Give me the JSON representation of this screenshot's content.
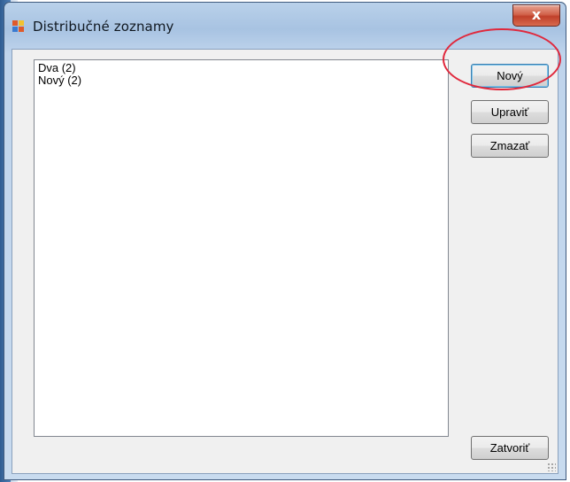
{
  "window": {
    "title": "Distribučné zoznamy",
    "close_glyph": "x"
  },
  "list": {
    "items": [
      {
        "label": "Dva (2)"
      },
      {
        "label": "Nový (2)"
      }
    ]
  },
  "buttons": {
    "new_label": "Nový",
    "edit_label": "Upraviť",
    "delete_label": "Zmazať",
    "close_label": "Zatvoriť"
  },
  "annotation": {
    "highlight_target": "new-button",
    "color": "#e0283c"
  },
  "icons": {
    "app": "window-app-icon",
    "close": "close-icon",
    "grip": "resize-grip-icon"
  }
}
